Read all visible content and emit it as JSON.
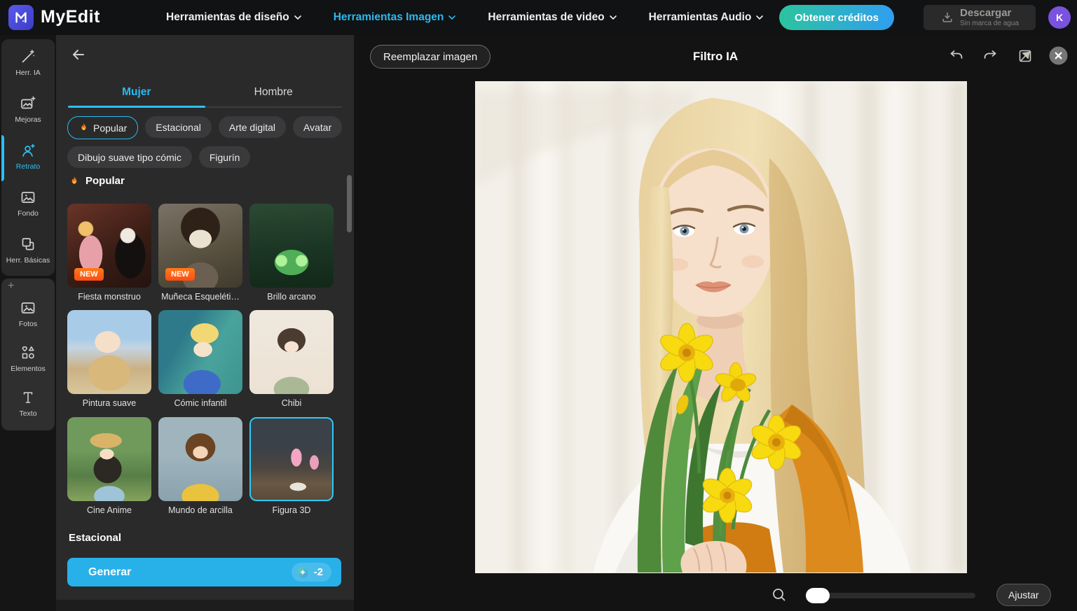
{
  "topnav": {
    "brand": "MyEdit",
    "menus": [
      {
        "label": "Herramientas de diseño"
      },
      {
        "label": "Herramientas Imagen"
      },
      {
        "label": "Herramientas de video"
      },
      {
        "label": "Herramientas Audio"
      }
    ],
    "credits_button": "Obtener créditos",
    "download": {
      "label": "Descargar",
      "sublabel": "Sin marca de agua"
    },
    "avatar_initial": "K"
  },
  "sidebar": {
    "group1": [
      {
        "label": "Herr. IA"
      },
      {
        "label": "Mejoras"
      },
      {
        "label": "Retrato"
      },
      {
        "label": "Fondo"
      },
      {
        "label": "Herr. Básicas"
      }
    ],
    "plus": "+",
    "group2": [
      {
        "label": "Fotos"
      },
      {
        "label": "Elementos"
      },
      {
        "label": "Texto"
      }
    ]
  },
  "panel": {
    "tabs": [
      {
        "label": "Mujer"
      },
      {
        "label": "Hombre"
      }
    ],
    "chips": [
      {
        "label": "Popular"
      },
      {
        "label": "Estacional"
      },
      {
        "label": "Arte digital"
      },
      {
        "label": "Avatar"
      },
      {
        "label": "Dibujo suave tipo cómic"
      },
      {
        "label": "Figurín"
      }
    ],
    "section_title": "Popular",
    "styles": [
      {
        "name": "Fiesta monstruo",
        "badge": "NEW"
      },
      {
        "name": "Muñeca Esqueléti…",
        "badge": "NEW"
      },
      {
        "name": "Brillo arcano"
      },
      {
        "name": "Pintura suave"
      },
      {
        "name": "Cómic infantil"
      },
      {
        "name": "Chibi"
      },
      {
        "name": "Cine Anime"
      },
      {
        "name": "Mundo de arcilla"
      },
      {
        "name": "Figura 3D"
      }
    ],
    "next_section_title": "Estacional",
    "generate": {
      "label": "Generar",
      "cost": "-2"
    }
  },
  "canvas": {
    "replace_button": "Reemplazar imagen",
    "title": "Filtro IA",
    "adjust_button": "Ajustar"
  },
  "colors": {
    "accent": "#2bb9f0",
    "credits_gradient_start": "#2cc49e",
    "credits_gradient_end": "#2f9ef0",
    "new_badge": "#ff5a1f",
    "avatar": "#7a52e0",
    "generate_button": "#28b0e9"
  }
}
